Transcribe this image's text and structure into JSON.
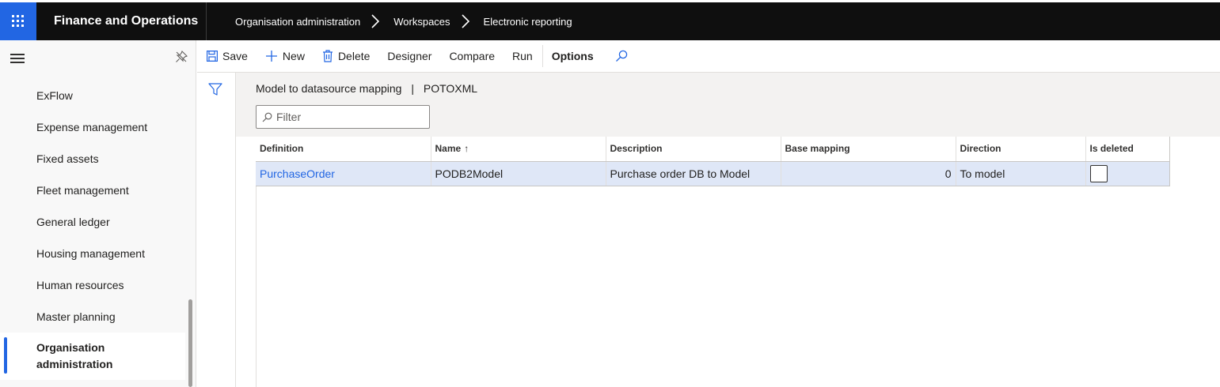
{
  "app": {
    "title": "Finance and Operations",
    "breadcrumbs": [
      "Organisation administration",
      "Workspaces",
      "Electronic reporting"
    ]
  },
  "nav": {
    "items": [
      {
        "label": "ExFlow",
        "active": false
      },
      {
        "label": "Expense management",
        "active": false
      },
      {
        "label": "Fixed assets",
        "active": false
      },
      {
        "label": "Fleet management",
        "active": false
      },
      {
        "label": "General ledger",
        "active": false
      },
      {
        "label": "Housing management",
        "active": false
      },
      {
        "label": "Human resources",
        "active": false
      },
      {
        "label": "Master planning",
        "active": false
      },
      {
        "label": "Organisation administration",
        "active": true
      }
    ]
  },
  "toolbar": {
    "save": "Save",
    "new": "New",
    "delete": "Delete",
    "designer": "Designer",
    "compare": "Compare",
    "run": "Run",
    "options": "Options"
  },
  "page": {
    "title": "Model to datasource mapping",
    "separator": "|",
    "subtitle": "POTOXML",
    "filter_placeholder": "Filter"
  },
  "grid": {
    "columns": [
      "Definition",
      "Name",
      "Description",
      "Base mapping",
      "Direction",
      "Is deleted"
    ],
    "sorted_column": "Name",
    "sort_direction": "ascending",
    "rows": [
      {
        "definition": "PurchaseOrder",
        "name": "PODB2Model",
        "description": "Purchase order DB to Model",
        "base_mapping": "0",
        "direction": "To model",
        "is_deleted": false
      }
    ]
  },
  "colors": {
    "accent": "#2266e3",
    "topbar": "#0f0f0f",
    "selected_row": "#dfe7f7"
  }
}
